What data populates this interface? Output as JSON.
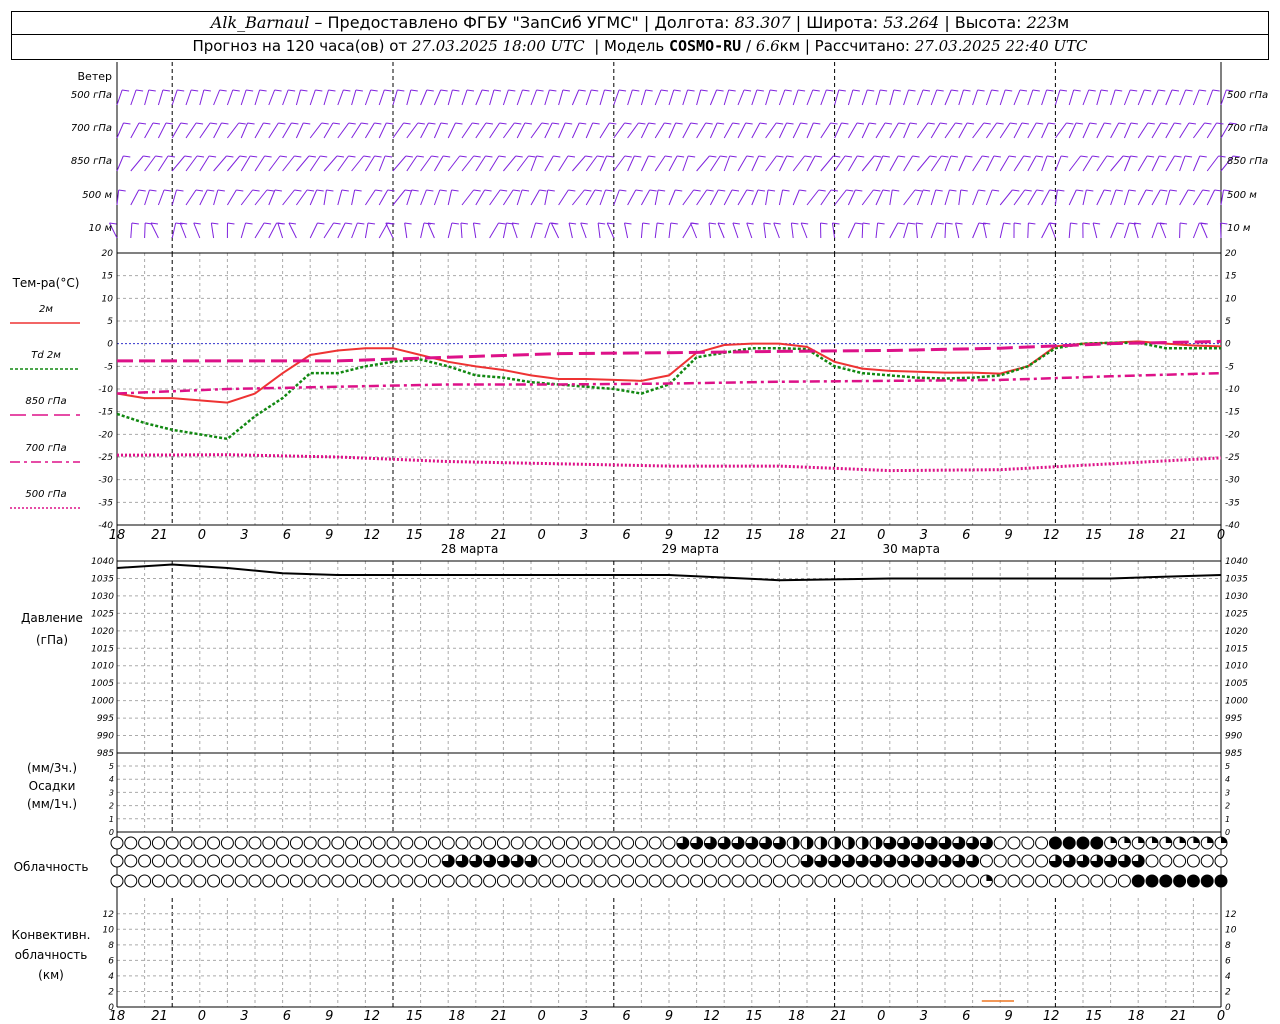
{
  "header": {
    "station": "Alk_Barnaul",
    "dash": " – ",
    "provider": "Предоставлено ФГБУ \"ЗапСиб УГМС\"",
    "lon_label": "Долгота:",
    "lon_value": "83.307",
    "lat_label": "Широта:",
    "lat_value": "53.264",
    "alt_label": "Высота:",
    "alt_value": "223",
    "alt_unit": "м",
    "forecast_label": "Прогноз на 120 часа(ов) от",
    "forecast_time": "27.03.2025 18:00 UTC",
    "model_label": "Модель",
    "model_name": "COSMO-RU",
    "model_res": "6.6",
    "model_res_unit": "км",
    "calc_label": "Рассчитано:",
    "calc_time": "27.03.2025 22:40 UTC"
  },
  "wind_panel": {
    "title": "Ветер",
    "levels": [
      "500 гПа",
      "700 гПа",
      "850 гПа",
      "500 м",
      "10  м"
    ]
  },
  "temp_panel": {
    "title": "Тем-ра(°С)",
    "legend": [
      "2м",
      "Td  2м",
      "850 гПа",
      "700 гПа",
      "500 гПа"
    ],
    "ticks": [
      "20",
      "15",
      "10",
      "5",
      "0",
      "-5",
      "-10",
      "-15",
      "-20",
      "-25",
      "-30",
      "-35",
      "-40"
    ]
  },
  "time_axis": {
    "hours": [
      "18",
      "21",
      "0",
      "3",
      "6",
      "9",
      "12",
      "15",
      "18",
      "21",
      "0",
      "3",
      "6",
      "9",
      "12",
      "15",
      "18",
      "21",
      "0",
      "3",
      "6",
      "9",
      "12",
      "15",
      "18",
      "21",
      "0"
    ],
    "dates": [
      "28 марта",
      "29 марта",
      "30 марта"
    ]
  },
  "pressure_panel": {
    "title": "Давление",
    "unit": "(гПа)",
    "ticks": [
      "1040",
      "1035",
      "1030",
      "1025",
      "1020",
      "1015",
      "1010",
      "1005",
      "1000",
      "995",
      "990",
      "985"
    ]
  },
  "precip_panel": {
    "label_top": "(мм/3ч.)",
    "title": "Осадки",
    "label_bottom": "(мм/1ч.)",
    "ticks": [
      "5",
      "4",
      "3",
      "2",
      "1",
      "0"
    ]
  },
  "cloud_panel": {
    "title": "Облачность"
  },
  "conv_panel": {
    "title_lines": [
      "Конвективн.",
      "облачность",
      "(км)"
    ],
    "ticks": [
      "12",
      "10",
      "8",
      "6",
      "4",
      "2",
      "0"
    ]
  },
  "colors": {
    "t2m": "#ee3333",
    "td2m": "#118811",
    "t850": "#dd1188",
    "t700": "#dd1188",
    "t500": "#dd1188",
    "pressure": "#000000",
    "wind": "#7f22dd",
    "grid": "#aaaaaa",
    "zero_line": "#3333cc",
    "conv": "#ee7722"
  },
  "chart_data": [
    {
      "type": "line",
      "title": "Тем-ра(°С)",
      "x_unit": "hours since 27.03.2025 18:00 UTC",
      "ylim": [
        -40,
        20
      ],
      "series": [
        {
          "name": "2м",
          "x": [
            0,
            3,
            6,
            9,
            12,
            15,
            18,
            21,
            24,
            27,
            30,
            33,
            36,
            39,
            42,
            45,
            48,
            51,
            54,
            57,
            60,
            63,
            66,
            69,
            72,
            75,
            78,
            81,
            84,
            87,
            90,
            93,
            96,
            99,
            102,
            105,
            108,
            111,
            114,
            117,
            120
          ],
          "values": [
            -11,
            -12,
            -12,
            -12.5,
            -13,
            -11,
            -6.5,
            -2.5,
            -1.5,
            -1,
            -1,
            -2.5,
            -4,
            -5,
            -5.8,
            -7,
            -7.8,
            -7.8,
            -8,
            -8.2,
            -7,
            -2,
            -0.3,
            0,
            0,
            -0.7,
            -4,
            -5.5,
            -6,
            -6.2,
            -6.4,
            -6.4,
            -6.6,
            -5,
            -0.6,
            0,
            0.2,
            0.5,
            0,
            -0.4,
            -0.6
          ]
        },
        {
          "name": "Td  2м",
          "x": [
            0,
            3,
            6,
            9,
            12,
            15,
            18,
            21,
            24,
            27,
            30,
            33,
            36,
            39,
            42,
            45,
            48,
            51,
            54,
            57,
            60,
            63,
            66,
            69,
            72,
            75,
            78,
            81,
            84,
            87,
            90,
            93,
            96,
            99,
            102,
            105,
            108,
            111,
            114,
            117,
            120
          ],
          "values": [
            -15.5,
            -17.5,
            -19,
            -20,
            -21,
            -16,
            -12,
            -6.5,
            -6.5,
            -5,
            -4,
            -3.5,
            -5,
            -7,
            -7.5,
            -8.5,
            -9,
            -9.5,
            -10,
            -11,
            -9,
            -3,
            -2,
            -1,
            -1,
            -1.2,
            -5,
            -6.5,
            -7,
            -7.5,
            -7.7,
            -7.5,
            -7,
            -5,
            -1,
            0,
            0.2,
            0.2,
            -1,
            -1,
            -1
          ]
        },
        {
          "name": "850 гПа",
          "x": [
            0,
            12,
            24,
            36,
            48,
            60,
            72,
            84,
            96,
            108,
            120
          ],
          "values": [
            -3.8,
            -3.8,
            -3.8,
            -3,
            -2.2,
            -2,
            -1.7,
            -1.5,
            -1,
            0,
            0.5
          ]
        },
        {
          "name": "700 гПа",
          "x": [
            0,
            12,
            24,
            36,
            48,
            60,
            72,
            84,
            96,
            108,
            120
          ],
          "values": [
            -11,
            -10,
            -9.5,
            -9,
            -9,
            -8.8,
            -8.4,
            -8.2,
            -8,
            -7.2,
            -6.5
          ]
        },
        {
          "name": "500 гПа",
          "x": [
            0,
            12,
            24,
            36,
            48,
            60,
            72,
            84,
            96,
            108,
            120
          ],
          "values": [
            -24.6,
            -24.5,
            -25,
            -26,
            -26.5,
            -27,
            -27,
            -28,
            -27.8,
            -26.5,
            -25.2
          ]
        }
      ]
    },
    {
      "type": "line",
      "title": "Давление",
      "x_unit": "hours since 27.03.2025 18:00 UTC",
      "ylim": [
        985,
        1040
      ],
      "series": [
        {
          "name": "",
          "x": [
            0,
            6,
            12,
            18,
            24,
            30,
            36,
            48,
            60,
            72,
            84,
            96,
            108,
            120
          ],
          "values": [
            1038,
            1039,
            1038,
            1036.5,
            1036,
            1036,
            1036,
            1036,
            1036,
            1034.5,
            1035,
            1035,
            1035,
            1036
          ]
        }
      ]
    },
    {
      "type": "line",
      "title": "Осадки",
      "ylim": [
        0,
        5
      ],
      "series": []
    },
    {
      "type": "line",
      "title": "Конвективн. облачность",
      "ylim": [
        0,
        13
      ],
      "series": []
    }
  ]
}
